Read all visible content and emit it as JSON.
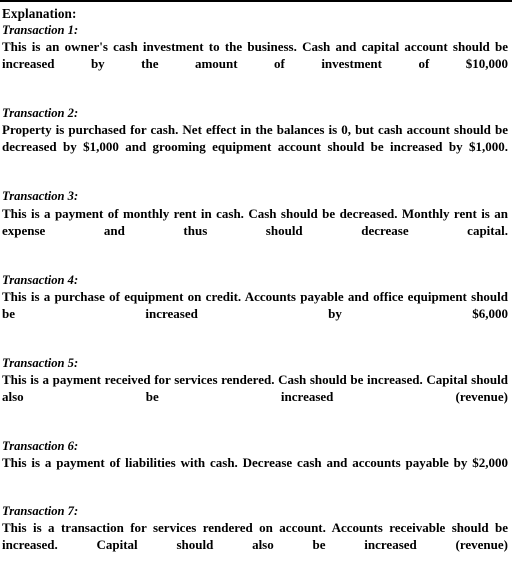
{
  "document": {
    "heading": "Explanation:",
    "transactions": [
      {
        "label": "Transaction 1:",
        "body": "This is an owner's cash investment to the business. Cash and capital account should be increased by the amount of investment of $10,000"
      },
      {
        "label": "Transaction 2:",
        "body": "Property is purchased for cash. Net effect in the balances is 0, but cash account should be decreased by $1,000 and grooming equipment account should be increased by $1,000."
      },
      {
        "label": "Transaction 3:",
        "body": "This is a payment of monthly rent in cash. Cash should be decreased. Monthly rent is an expense and thus should decrease capital."
      },
      {
        "label": "Transaction 4:",
        "body": "This is a purchase of equipment on credit. Accounts payable and office equipment should be increased by $6,000"
      },
      {
        "label": "Transaction 5:",
        "body": "This is a payment received for services rendered. Cash should be increased. Capital should also be increased (revenue)"
      },
      {
        "label": "Transaction 6:",
        "body": "This is a payment of liabilities with cash. Decrease cash and accounts payable by $2,000"
      },
      {
        "label": "Transaction 7:",
        "body": "This is a transaction for services rendered on account. Accounts receivable should be increased. Capital should also be increased (revenue)"
      }
    ]
  }
}
